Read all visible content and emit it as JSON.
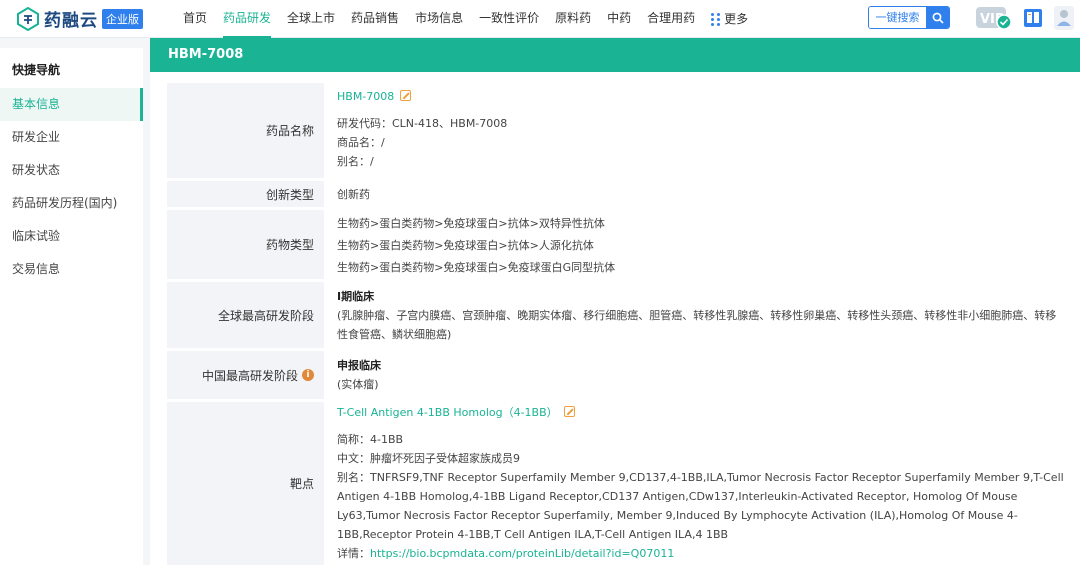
{
  "header": {
    "logo_text": "药融云",
    "logo_badge": "企业版",
    "nav": [
      "首页",
      "药品研发",
      "全球上市",
      "药品销售",
      "市场信息",
      "一致性评价",
      "原料药",
      "中药",
      "合理用药"
    ],
    "active_nav": 1,
    "more_label": "更多",
    "search_placeholder": "一键搜索",
    "vip_label": "VIP"
  },
  "sidebar": {
    "title": "快捷导航",
    "items": [
      "基本信息",
      "研发企业",
      "研发状态",
      "药品研发历程(国内)",
      "临床试验",
      "交易信息"
    ],
    "active": 0
  },
  "drug": {
    "title": "HBM-7008",
    "name": {
      "label": "药品名称",
      "link": "HBM-7008",
      "code": "研发代码：CLN-418、HBM-7008",
      "trade_name": "商品名：/",
      "alias": "别名：/"
    },
    "innovation": {
      "label": "创新类型",
      "value": "创新药"
    },
    "drug_type": {
      "label": "药物类型",
      "lines": [
        "生物药>蛋白类药物>免疫球蛋白>抗体>双特异性抗体",
        "生物药>蛋白类药物>免疫球蛋白>抗体>人源化抗体",
        "生物药>蛋白类药物>免疫球蛋白>免疫球蛋白G同型抗体"
      ]
    },
    "global_phase": {
      "label": "全球最高研发阶段",
      "phase": "Ⅰ期临床",
      "indications": "(乳腺肿瘤、子宫内膜癌、宫颈肿瘤、晚期实体瘤、移行细胞癌、胆管癌、转移性乳腺癌、转移性卵巢癌、转移性头颈癌、转移性非小细胞肺癌、转移性食管癌、鳞状细胞癌)"
    },
    "china_phase": {
      "label": "中国最高研发阶段",
      "phase": "申报临床",
      "indications": "(实体瘤)"
    },
    "target": {
      "label": "靶点",
      "link": "T-Cell Antigen 4-1BB Homolog（4-1BB）",
      "abbr": "简称：4-1BB",
      "chinese": "中文：肿瘤坏死因子受体超家族成员9",
      "alias": "别名：TNFRSF9,TNF Receptor Superfamily Member 9,CD137,4-1BB,ILA,Tumor Necrosis Factor Receptor Superfamily Member 9,T-Cell Antigen 4-1BB Homolog,4-1BB Ligand Receptor,CD137 Antigen,CDw137,Interleukin-Activated Receptor, Homolog Of Mouse Ly63,Tumor Necrosis Factor Receptor Superfamily, Member 9,Induced By Lymphocyte Activation (ILA),Homolog Of Mouse 4-1BB,Receptor Protein 4-1BB,T Cell Antigen ILA,T-Cell Antigen ILA,4 1BB",
      "detail_label": "详情：",
      "detail_url": "https://bio.bcpmdata.com/proteinLib/detail?id=Q07011"
    }
  },
  "colors": {
    "accent": "#1ab394",
    "brand_blue": "#2f80ed",
    "info_orange": "#e2883a"
  },
  "icons": [
    "logo-icon",
    "search-icon",
    "vip-icon",
    "book-icon",
    "user-icon",
    "edit-icon",
    "info-icon",
    "grid-dots-icon"
  ]
}
